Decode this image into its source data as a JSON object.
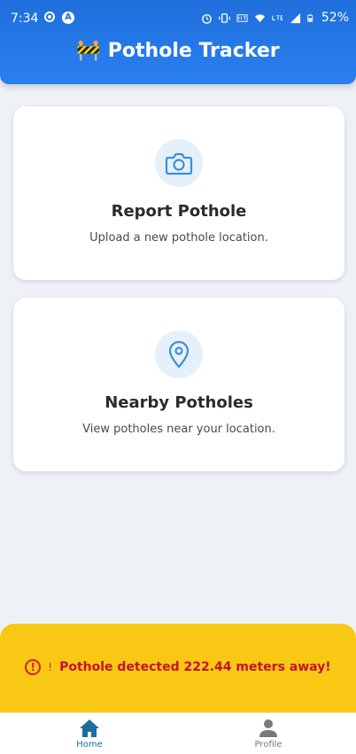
{
  "status_bar": {
    "time": "7:34",
    "battery": "52%",
    "icons": [
      "location-icon",
      "a-icon",
      "alarm-icon",
      "vibrate-icon",
      "volte-icon",
      "wifi-icon",
      "lte-icon",
      "signal-icon",
      "battery-icon"
    ]
  },
  "header": {
    "title": "Pothole Tracker",
    "title_emoji": "🚧",
    "background": "#1f6fdc"
  },
  "cards": [
    {
      "title": "Report Pothole",
      "description": "Upload a new pothole location.",
      "icon": "camera-icon"
    },
    {
      "title": "Nearby Potholes",
      "description": "View potholes near your location.",
      "icon": "map-pin-icon"
    }
  ],
  "alert": {
    "icon": "!",
    "warn_symbol": "!",
    "text": "Pothole detected 222.44 meters away!",
    "background": "#f8c814",
    "text_color": "#c8102e"
  },
  "bottom_nav": {
    "items": [
      {
        "label": "Home",
        "icon": "home-icon",
        "active": true
      },
      {
        "label": "Profile",
        "icon": "profile-icon",
        "active": false
      }
    ],
    "active_color": "#1a6fa0"
  }
}
